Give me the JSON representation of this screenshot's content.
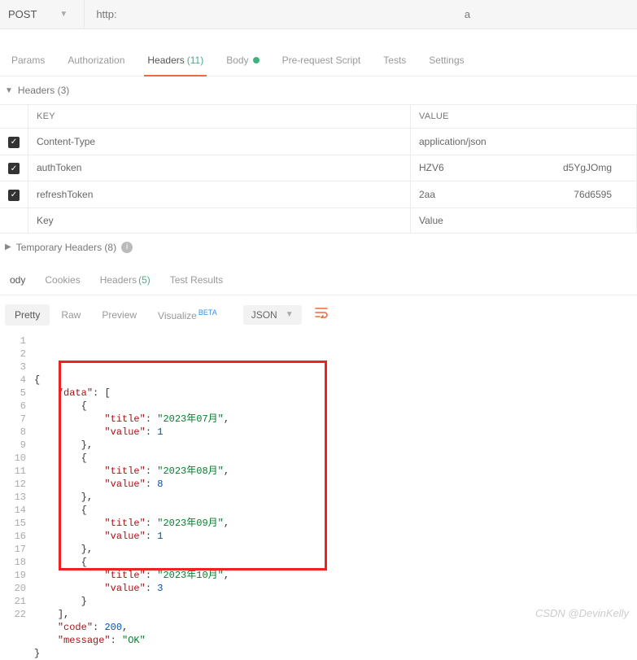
{
  "request": {
    "method": "POST",
    "url_prefix": "http:",
    "url_suffix": "a"
  },
  "tabs": {
    "params": "Params",
    "authorization": "Authorization",
    "headers": "Headers",
    "headers_count": "(11)",
    "body": "Body",
    "prerequest": "Pre-request Script",
    "tests": "Tests",
    "settings": "Settings"
  },
  "headers_section": {
    "title": "Headers (3)",
    "col_key": "KEY",
    "col_value": "VALUE",
    "rows": [
      {
        "key": "Content-Type",
        "value": "application/json",
        "value2": ""
      },
      {
        "key": "authToken",
        "value": "HZV6",
        "value2": "d5YgJOmg"
      },
      {
        "key": "refreshToken",
        "value": "2aa",
        "value2": "76d6595"
      }
    ],
    "placeholder_key": "Key",
    "placeholder_value": "Value"
  },
  "temp_headers": {
    "title": "Temporary Headers (8)"
  },
  "response_tabs": {
    "body": "ody",
    "cookies": "Cookies",
    "headers": "Headers",
    "headers_count": "(5)",
    "test_results": "Test Results"
  },
  "viewbar": {
    "pretty": "Pretty",
    "raw": "Raw",
    "preview": "Preview",
    "visualize": "Visualize",
    "beta": "BETA",
    "format": "JSON"
  },
  "code_lines": [
    "{",
    "    \"data\": [",
    "        {",
    "            \"title\": \"2023年07月\",",
    "            \"value\": 1",
    "        },",
    "        {",
    "            \"title\": \"2023年08月\",",
    "            \"value\": 8",
    "        },",
    "        {",
    "            \"title\": \"2023年09月\",",
    "            \"value\": 1",
    "        },",
    "        {",
    "            \"title\": \"2023年10月\",",
    "            \"value\": 3",
    "        }",
    "    ],",
    "    \"code\": 200,",
    "    \"message\": \"OK\"",
    "}"
  ],
  "response_body": {
    "data": [
      {
        "title": "2023年07月",
        "value": 1
      },
      {
        "title": "2023年08月",
        "value": 8
      },
      {
        "title": "2023年09月",
        "value": 1
      },
      {
        "title": "2023年10月",
        "value": 3
      }
    ],
    "code": 200,
    "message": "OK"
  },
  "watermark": "CSDN @DevinKelly"
}
